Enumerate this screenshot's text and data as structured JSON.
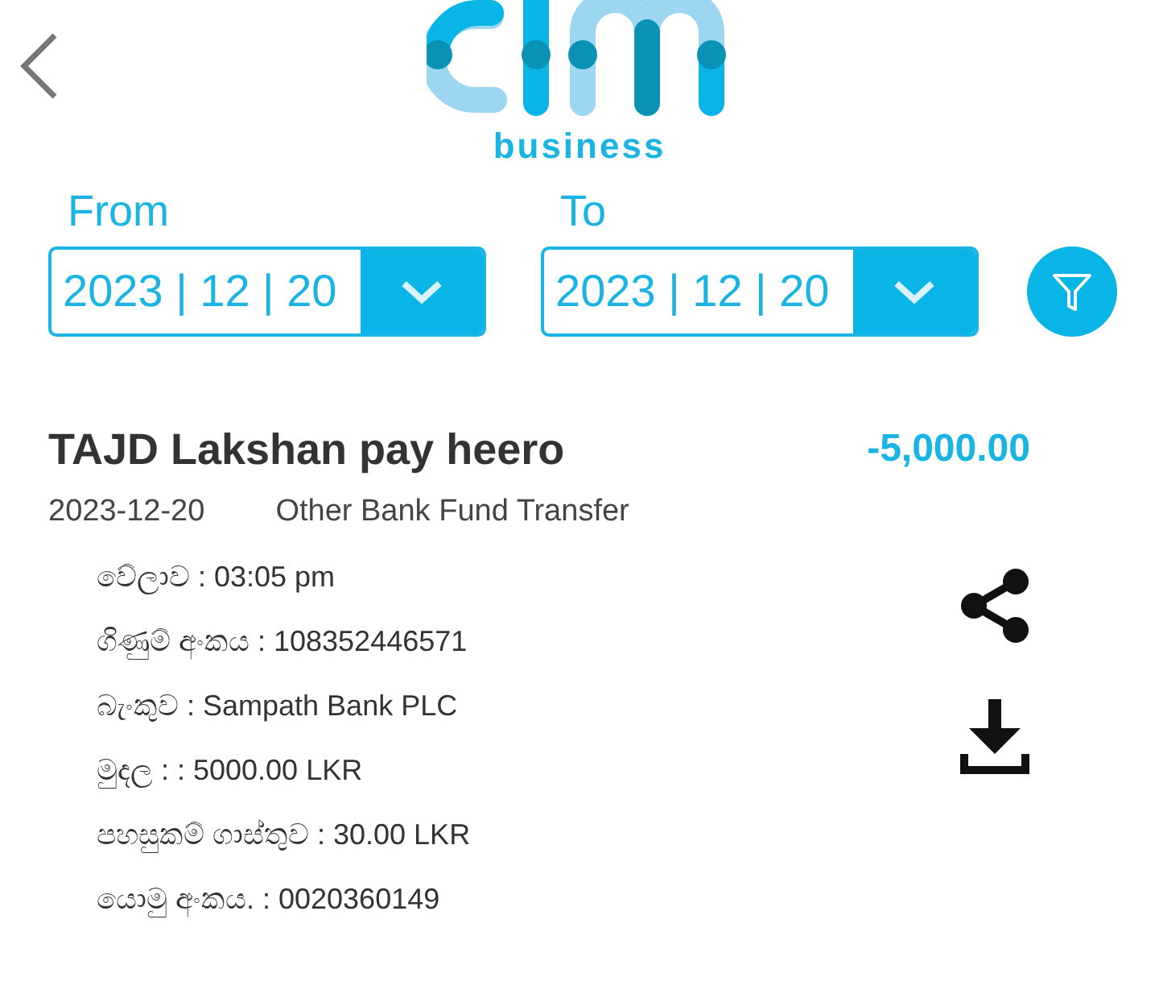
{
  "header": {
    "logo_subtitle": "business"
  },
  "filters": [
    {
      "label": "From",
      "value": "2023 | 12 | 20"
    },
    {
      "label": "To",
      "value": "2023 | 12 | 20"
    }
  ],
  "transaction": {
    "title": "TAJD Lakshan pay heero",
    "amount": "-5,000.00",
    "date": "2023-12-20",
    "type": "Other Bank Fund Transfer",
    "details": [
      "වේලාව  : 03:05 pm",
      "ගිණුම් අංකය  : 108352446571",
      "බැංකුව  : Sampath Bank PLC",
      "මුදල : : 5000.00 LKR",
      "පහසුකම් ගාස්තුව : 30.00 LKR",
      "යොමු අංකය.  : 0020360149"
    ]
  }
}
